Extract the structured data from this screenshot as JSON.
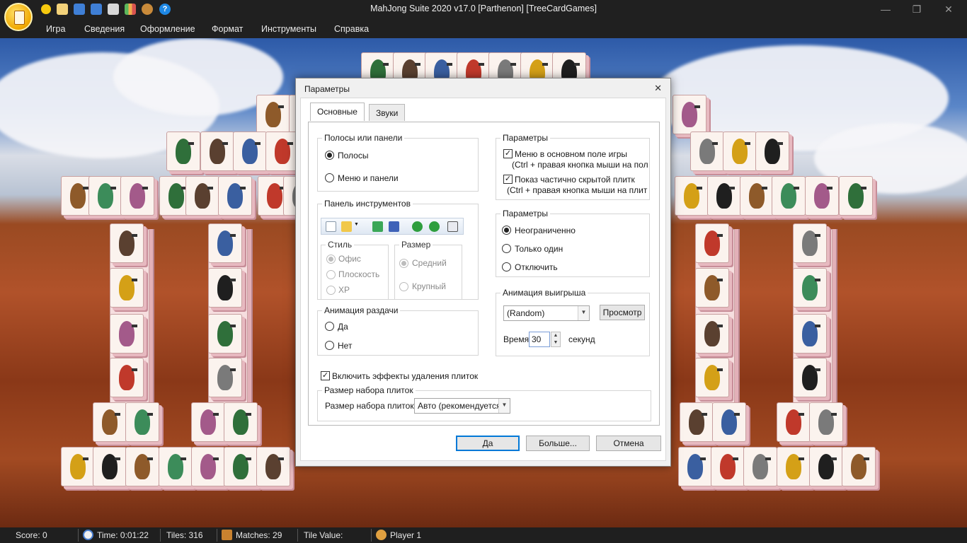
{
  "window": {
    "title": "MahJong Suite 2020 v17.0  [Parthenon]  [TreeCardGames]",
    "controls": {
      "minimize": "—",
      "restore": "❐",
      "close": "✕"
    }
  },
  "menu": [
    "Игра",
    "Сведения",
    "Оформление",
    "Формат",
    "Инструменты",
    "Справка"
  ],
  "dialog": {
    "title": "Параметры",
    "close": "✕",
    "tabs": [
      "Основные",
      "Звуки"
    ],
    "bars_panels": {
      "title": "Полосы или панели",
      "options": [
        {
          "label": "Полосы",
          "selected": true
        },
        {
          "label": "Меню и панели",
          "selected": false
        }
      ]
    },
    "toolbar_panel": {
      "title": "Панель инструментов",
      "style": {
        "title": "Стиль",
        "options": [
          {
            "label": "Офис",
            "selected": true
          },
          {
            "label": "Плоскость",
            "selected": false
          },
          {
            "label": "XP",
            "selected": false
          }
        ]
      },
      "size": {
        "title": "Размер",
        "options": [
          {
            "label": "Средний",
            "selected": true
          },
          {
            "label": "Крупный",
            "selected": false
          }
        ]
      }
    },
    "deal_animation": {
      "title": "Анимация раздачи",
      "options": [
        {
          "label": "Да",
          "selected": false
        },
        {
          "label": "Нет",
          "selected": false
        }
      ]
    },
    "removal_effects": {
      "label": "Включить эффекты удаления плиток",
      "checked": true
    },
    "tileset": {
      "title": "Размер набора плиток",
      "label": "Размер набора плиток",
      "value": "Авто (рекомендуется"
    },
    "params_right": {
      "title": "Параметры",
      "menu_in_field": {
        "label": "Меню в основном поле игры",
        "hint": "(Ctrl + правая кнопка мыши на пол",
        "checked": true
      },
      "partial_tile": {
        "label": "Показ частично скрытой плитк",
        "hint": "(Ctrl + правая кнопка мыши на плит",
        "checked": true
      }
    },
    "params_limit": {
      "title": "Параметры",
      "options": [
        {
          "label": "Неограниченно",
          "selected": true
        },
        {
          "label": "Только один",
          "selected": false
        },
        {
          "label": "Отключить",
          "selected": false
        }
      ]
    },
    "win_animation": {
      "title": "Анимация выигрыша",
      "value": "(Random)",
      "preview": "Просмотр",
      "time_label": "Время:",
      "time_value": "30",
      "unit": "секунд"
    },
    "buttons": {
      "ok": "Да",
      "more": "Больше...",
      "cancel": "Отмена"
    }
  },
  "status": {
    "score": "Score: 0",
    "time": "Time: 0:01:22",
    "tiles": "Tiles: 316",
    "matches": "Matches: 29",
    "tile_value": "Tile Value:",
    "player": "Player 1"
  }
}
